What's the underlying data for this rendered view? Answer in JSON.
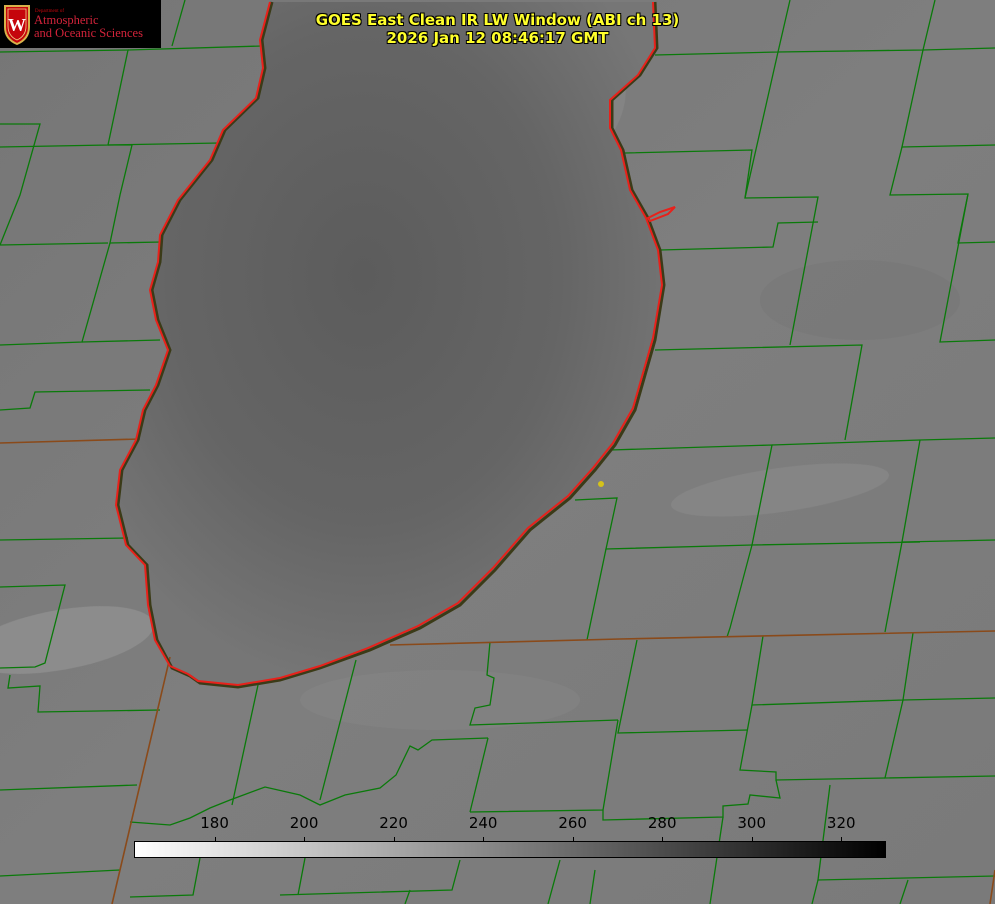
{
  "title": {
    "line1": "GOES East Clean IR LW Window (ABI ch 13)",
    "line2": "2026 Jan 12 08:46:17 GMT"
  },
  "logo": {
    "department_label": "Department of",
    "line1": "Atmospheric",
    "line2": "and Oceanic Sciences",
    "crest_letter": "W",
    "crest_icon": "uw-crest-icon"
  },
  "colorbar": {
    "units_shown": "",
    "min_value": 162,
    "max_value": 330,
    "gradient_from": "#ffffff",
    "gradient_to": "#000000",
    "ticks": [
      {
        "value": 180,
        "label": "180"
      },
      {
        "value": 200,
        "label": "200"
      },
      {
        "value": 220,
        "label": "220"
      },
      {
        "value": 240,
        "label": "240"
      },
      {
        "value": 260,
        "label": "260"
      },
      {
        "value": 280,
        "label": "280"
      },
      {
        "value": 300,
        "label": "300"
      },
      {
        "value": 320,
        "label": "320"
      }
    ]
  },
  "colors": {
    "lake_outline": "#e8211b",
    "county_lines": "#0a7a0a",
    "state_lines": "#8a4a1a",
    "title_text": "#ffff2b",
    "station_marker": "#d4c21a"
  },
  "map_layers": [
    "ir-imagery",
    "lake-shoreline",
    "county-boundaries",
    "state-boundaries",
    "station-marker"
  ]
}
